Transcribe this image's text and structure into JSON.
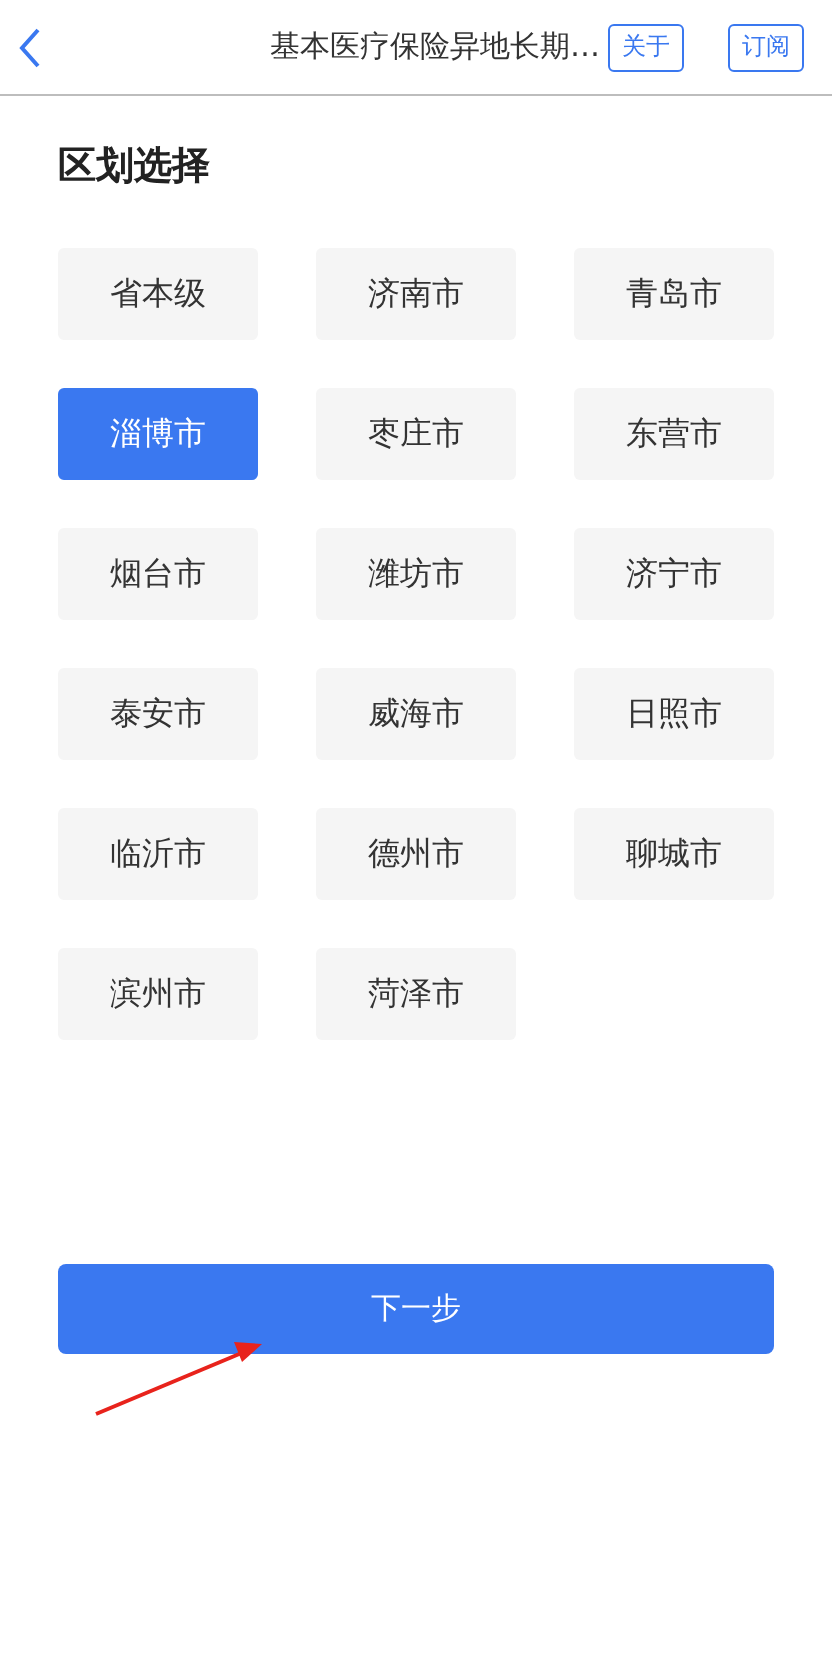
{
  "header": {
    "title": "基本医疗保险异地长期…",
    "buttons": [
      "关于",
      "订阅"
    ]
  },
  "section_title": "区划选择",
  "regions": [
    {
      "label": "省本级",
      "selected": false
    },
    {
      "label": "济南市",
      "selected": false
    },
    {
      "label": "青岛市",
      "selected": false
    },
    {
      "label": "淄博市",
      "selected": true
    },
    {
      "label": "枣庄市",
      "selected": false
    },
    {
      "label": "东营市",
      "selected": false
    },
    {
      "label": "烟台市",
      "selected": false
    },
    {
      "label": "潍坊市",
      "selected": false
    },
    {
      "label": "济宁市",
      "selected": false
    },
    {
      "label": "泰安市",
      "selected": false
    },
    {
      "label": "威海市",
      "selected": false
    },
    {
      "label": "日照市",
      "selected": false
    },
    {
      "label": "临沂市",
      "selected": false
    },
    {
      "label": "德州市",
      "selected": false
    },
    {
      "label": "聊城市",
      "selected": false
    },
    {
      "label": "滨州市",
      "selected": false
    },
    {
      "label": "菏泽市",
      "selected": false
    }
  ],
  "next_button": "下一步"
}
